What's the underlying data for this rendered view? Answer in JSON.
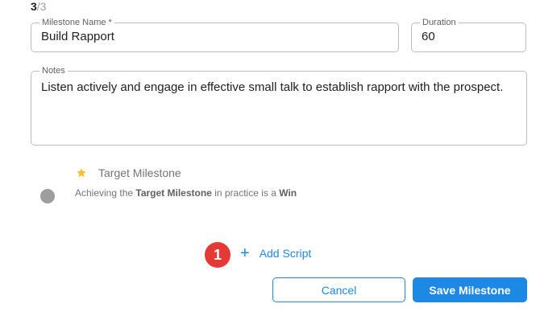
{
  "step": {
    "current": "3",
    "total": "/3"
  },
  "milestone_name": {
    "label": "Milestone Name *",
    "value": "Build Rapport"
  },
  "duration": {
    "label": "Duration",
    "value": "60"
  },
  "notes": {
    "label": "Notes",
    "value": "Listen actively and engage in effective small talk to establish rapport with the prospect."
  },
  "target_milestone": {
    "label": "Target Milestone",
    "hint_prefix": "Achieving the ",
    "hint_bold1": "Target Milestone",
    "hint_middle": " in practice is a ",
    "hint_bold2": "Win"
  },
  "badge": "1",
  "add_script_label": "Add Script",
  "buttons": {
    "cancel": "Cancel",
    "save": "Save Milestone"
  },
  "colors": {
    "accent": "#1e88e5",
    "star": "#fbc02d",
    "badge": "#e53935"
  }
}
